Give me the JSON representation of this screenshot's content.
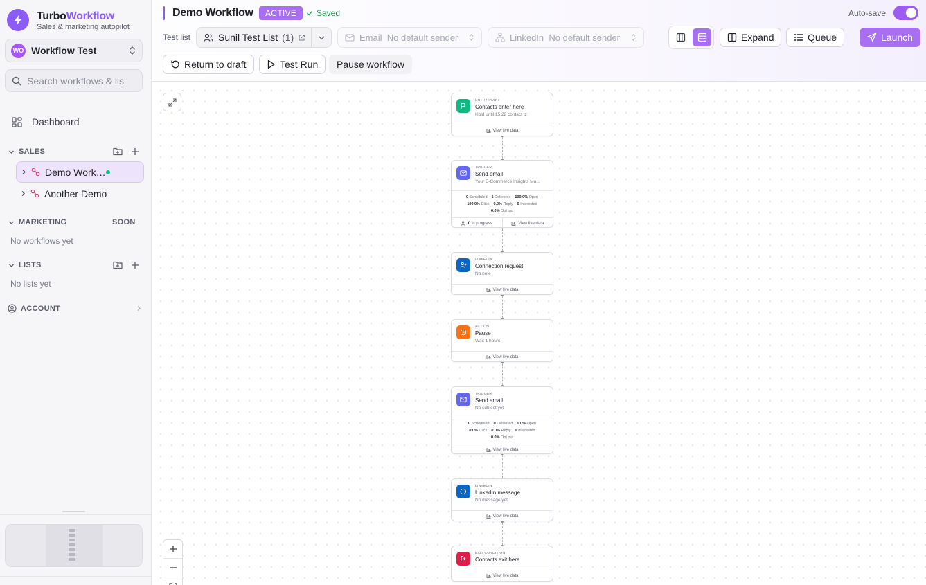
{
  "sidebar": {
    "brand_part1": "Turbo",
    "brand_part2": "Workflow",
    "tagline": "Sales & marketing autopilot",
    "workspace": {
      "initials": "WO",
      "name": "Workflow Test"
    },
    "search_placeholder": "Search workflows & lists",
    "dashboard_label": "Dashboard",
    "sections": {
      "sales": "SALES",
      "marketing": "MARKETING",
      "marketing_badge": "SOON",
      "lists": "LISTS",
      "account": "ACCOUNT"
    },
    "sales_items": [
      {
        "label": "Demo Workflow",
        "active": true
      },
      {
        "label": "Another Demo",
        "active": false
      }
    ],
    "marketing_empty": "No workflows yet",
    "lists_empty": "No lists yet"
  },
  "header": {
    "title": "Demo Workflow",
    "status_badge": "ACTIVE",
    "saved_text": "Saved",
    "autosave_label": "Auto-save",
    "autosave_on": true,
    "test_list_label": "Test list",
    "test_list_name": "Sunil Test List",
    "test_list_count": "(1)",
    "email_sender": {
      "label": "Email",
      "value": "No default sender"
    },
    "linkedin_sender": {
      "label": "LinkedIn",
      "value": "No default sender"
    },
    "expand_label": "Expand",
    "queue_label": "Queue",
    "launch_label": "Launch",
    "return_label": "Return to draft",
    "testrun_label": "Test Run",
    "pause_label": "Pause workflow"
  },
  "colors": {
    "accent": "#8b5cf6",
    "status_green": "#16a34a",
    "entry": "#10b981",
    "email": "#6366f1",
    "linkedin": "#0a66c2",
    "pause": "#f97316",
    "exit": "#e11d48"
  },
  "nodes": {
    "n1": {
      "kind": "ENTRY POINT",
      "title": "Contacts enter here",
      "sub": "Hold until 15:22 contact tz",
      "footer": "View live data",
      "icon": "flag-icon"
    },
    "n2": {
      "kind": "TRIGGER",
      "title": "Send email",
      "sub": "Your E-Commerce Insights Ma...",
      "icon": "mail-icon",
      "stats": {
        "scheduled": "0",
        "delivered": "1",
        "open": "100.0%",
        "click": "100.0%",
        "reply": "0.0%",
        "interested": "0",
        "optout": "0.0%"
      },
      "labels": {
        "scheduled": "Scheduled",
        "delivered": "Delivered",
        "open": "Open",
        "click": "Click",
        "reply": "Reply",
        "interested": "Interested",
        "optout": "Opt out"
      },
      "in_progress_count": "0",
      "in_progress_label": "in progress",
      "footer": "View live data"
    },
    "n3": {
      "kind": "LINKEDIN",
      "title": "Connection request",
      "sub": "No note",
      "footer": "View live data",
      "icon": "user-plus-icon"
    },
    "n4": {
      "kind": "ACTION",
      "title": "Pause",
      "sub": "Wait 1 hours",
      "footer": "View live data",
      "icon": "clock-icon"
    },
    "n5": {
      "kind": "TRIGGER",
      "title": "Send email",
      "sub": "No subject yet",
      "icon": "mail-icon",
      "stats": {
        "scheduled": "0",
        "delivered": "0",
        "open": "0.0%",
        "click": "0.0%",
        "reply": "0.0%",
        "interested": "0",
        "optout": "0.0%"
      },
      "labels": {
        "scheduled": "Scheduled",
        "delivered": "Delivered",
        "open": "Open",
        "click": "Click",
        "reply": "Reply",
        "interested": "Interested",
        "optout": "Opt out"
      },
      "footer": "View live data"
    },
    "n6": {
      "kind": "LINKEDIN",
      "title": "LinkedIn message",
      "sub": "No message yet",
      "footer": "View live data",
      "icon": "message-icon"
    },
    "n7": {
      "kind": "EXIT CONDITION",
      "title": "Contacts exit here",
      "footer": "View live data",
      "icon": "exit-icon"
    }
  }
}
